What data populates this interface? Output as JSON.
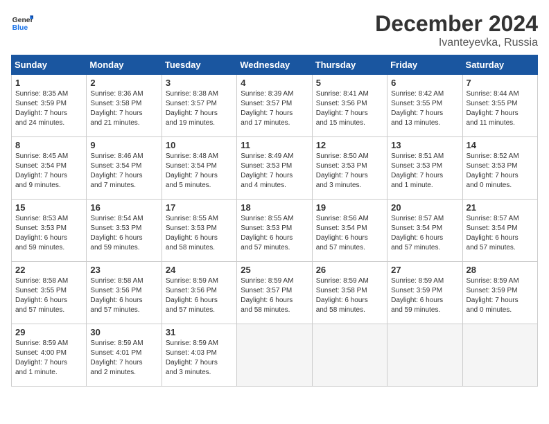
{
  "header": {
    "logo_line1": "General",
    "logo_line2": "Blue",
    "month_year": "December 2024",
    "location": "Ivanteyevka, Russia"
  },
  "weekdays": [
    "Sunday",
    "Monday",
    "Tuesday",
    "Wednesday",
    "Thursday",
    "Friday",
    "Saturday"
  ],
  "weeks": [
    [
      {
        "day": 1,
        "info": "Sunrise: 8:35 AM\nSunset: 3:59 PM\nDaylight: 7 hours\nand 24 minutes."
      },
      {
        "day": 2,
        "info": "Sunrise: 8:36 AM\nSunset: 3:58 PM\nDaylight: 7 hours\nand 21 minutes."
      },
      {
        "day": 3,
        "info": "Sunrise: 8:38 AM\nSunset: 3:57 PM\nDaylight: 7 hours\nand 19 minutes."
      },
      {
        "day": 4,
        "info": "Sunrise: 8:39 AM\nSunset: 3:57 PM\nDaylight: 7 hours\nand 17 minutes."
      },
      {
        "day": 5,
        "info": "Sunrise: 8:41 AM\nSunset: 3:56 PM\nDaylight: 7 hours\nand 15 minutes."
      },
      {
        "day": 6,
        "info": "Sunrise: 8:42 AM\nSunset: 3:55 PM\nDaylight: 7 hours\nand 13 minutes."
      },
      {
        "day": 7,
        "info": "Sunrise: 8:44 AM\nSunset: 3:55 PM\nDaylight: 7 hours\nand 11 minutes."
      }
    ],
    [
      {
        "day": 8,
        "info": "Sunrise: 8:45 AM\nSunset: 3:54 PM\nDaylight: 7 hours\nand 9 minutes."
      },
      {
        "day": 9,
        "info": "Sunrise: 8:46 AM\nSunset: 3:54 PM\nDaylight: 7 hours\nand 7 minutes."
      },
      {
        "day": 10,
        "info": "Sunrise: 8:48 AM\nSunset: 3:54 PM\nDaylight: 7 hours\nand 5 minutes."
      },
      {
        "day": 11,
        "info": "Sunrise: 8:49 AM\nSunset: 3:53 PM\nDaylight: 7 hours\nand 4 minutes."
      },
      {
        "day": 12,
        "info": "Sunrise: 8:50 AM\nSunset: 3:53 PM\nDaylight: 7 hours\nand 3 minutes."
      },
      {
        "day": 13,
        "info": "Sunrise: 8:51 AM\nSunset: 3:53 PM\nDaylight: 7 hours\nand 1 minute."
      },
      {
        "day": 14,
        "info": "Sunrise: 8:52 AM\nSunset: 3:53 PM\nDaylight: 7 hours\nand 0 minutes."
      }
    ],
    [
      {
        "day": 15,
        "info": "Sunrise: 8:53 AM\nSunset: 3:53 PM\nDaylight: 6 hours\nand 59 minutes."
      },
      {
        "day": 16,
        "info": "Sunrise: 8:54 AM\nSunset: 3:53 PM\nDaylight: 6 hours\nand 59 minutes."
      },
      {
        "day": 17,
        "info": "Sunrise: 8:55 AM\nSunset: 3:53 PM\nDaylight: 6 hours\nand 58 minutes."
      },
      {
        "day": 18,
        "info": "Sunrise: 8:55 AM\nSunset: 3:53 PM\nDaylight: 6 hours\nand 57 minutes."
      },
      {
        "day": 19,
        "info": "Sunrise: 8:56 AM\nSunset: 3:54 PM\nDaylight: 6 hours\nand 57 minutes."
      },
      {
        "day": 20,
        "info": "Sunrise: 8:57 AM\nSunset: 3:54 PM\nDaylight: 6 hours\nand 57 minutes."
      },
      {
        "day": 21,
        "info": "Sunrise: 8:57 AM\nSunset: 3:54 PM\nDaylight: 6 hours\nand 57 minutes."
      }
    ],
    [
      {
        "day": 22,
        "info": "Sunrise: 8:58 AM\nSunset: 3:55 PM\nDaylight: 6 hours\nand 57 minutes."
      },
      {
        "day": 23,
        "info": "Sunrise: 8:58 AM\nSunset: 3:56 PM\nDaylight: 6 hours\nand 57 minutes."
      },
      {
        "day": 24,
        "info": "Sunrise: 8:59 AM\nSunset: 3:56 PM\nDaylight: 6 hours\nand 57 minutes."
      },
      {
        "day": 25,
        "info": "Sunrise: 8:59 AM\nSunset: 3:57 PM\nDaylight: 6 hours\nand 58 minutes."
      },
      {
        "day": 26,
        "info": "Sunrise: 8:59 AM\nSunset: 3:58 PM\nDaylight: 6 hours\nand 58 minutes."
      },
      {
        "day": 27,
        "info": "Sunrise: 8:59 AM\nSunset: 3:59 PM\nDaylight: 6 hours\nand 59 minutes."
      },
      {
        "day": 28,
        "info": "Sunrise: 8:59 AM\nSunset: 3:59 PM\nDaylight: 7 hours\nand 0 minutes."
      }
    ],
    [
      {
        "day": 29,
        "info": "Sunrise: 8:59 AM\nSunset: 4:00 PM\nDaylight: 7 hours\nand 1 minute."
      },
      {
        "day": 30,
        "info": "Sunrise: 8:59 AM\nSunset: 4:01 PM\nDaylight: 7 hours\nand 2 minutes."
      },
      {
        "day": 31,
        "info": "Sunrise: 8:59 AM\nSunset: 4:03 PM\nDaylight: 7 hours\nand 3 minutes."
      },
      null,
      null,
      null,
      null
    ]
  ]
}
